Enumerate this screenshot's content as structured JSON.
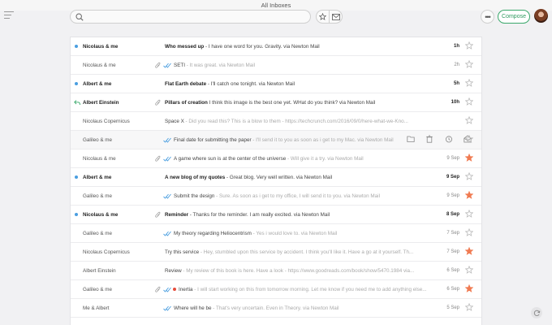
{
  "window": {
    "title": "All Inboxes"
  },
  "toolbar": {
    "search_placeholder": "",
    "more_label": "•••",
    "compose_label": "Compose"
  },
  "colors": {
    "accent": "#2f9a5f",
    "unread_dot": "#4a9ee0",
    "star_active": "#f07b52",
    "label_red": "#e64b3b"
  },
  "icons": [
    "menu-icon",
    "search-icon",
    "star-filter-icon",
    "envelope-filter-icon",
    "more-icon",
    "avatar",
    "reply-icon",
    "paperclip-icon",
    "read-receipt-icon",
    "star-icon",
    "folder-icon",
    "trash-icon",
    "snooze-icon",
    "mark-read-icon",
    "refresh-icon"
  ],
  "emails": [
    {
      "sender": "Nicolaus & me",
      "subject": "Who messed up",
      "preview": " - I have one word for you. Gravity. via Newton Mail",
      "date": "1h",
      "unread": true,
      "dot": true,
      "replied": false,
      "attachment": false,
      "receipt": false,
      "red": false,
      "starred": false,
      "hover": false
    },
    {
      "sender": "Nicolaus & me",
      "subject": "SETI",
      "preview": " - It was great. via Newton Mail",
      "date": "2h",
      "unread": false,
      "dot": false,
      "replied": false,
      "attachment": true,
      "receipt": true,
      "red": false,
      "starred": false,
      "hover": false
    },
    {
      "sender": "Albert & me",
      "subject": "Flat Earth debate",
      "preview": " - I'll catch one tonight. via Newton Mail",
      "date": "5h",
      "unread": true,
      "dot": true,
      "replied": false,
      "attachment": false,
      "receipt": false,
      "red": false,
      "starred": false,
      "hover": false
    },
    {
      "sender": "Albert Einstein",
      "subject": "Pillars of creation",
      "preview": "    I think this image is the best one yet. WHat do you think? via Newton Mail",
      "date": "10h",
      "unread": true,
      "dot": false,
      "replied": true,
      "attachment": true,
      "receipt": false,
      "red": false,
      "starred": false,
      "hover": false
    },
    {
      "sender": "Nicolaus Copernicus",
      "subject": "Space X",
      "preview": " - Did you read this? This is a blow to them - https://techcrunch.com/2016/09/0/here-what-we-Kno...",
      "date": "",
      "unread": false,
      "dot": false,
      "replied": false,
      "attachment": false,
      "receipt": false,
      "red": false,
      "starred": false,
      "hover": false
    },
    {
      "sender": "Galileo & me",
      "subject": "Final date for submitting the paper",
      "preview": " - I'll send it to you as soon as i get to my Mac. via Newton Mail",
      "date": "",
      "unread": false,
      "dot": false,
      "replied": false,
      "attachment": false,
      "receipt": true,
      "red": false,
      "starred": false,
      "hover": true
    },
    {
      "sender": "Nicolaus & me",
      "subject": "A game where sun is at the center of the universe",
      "preview": " - Will give it a try. via Newton Mail",
      "date": "9 Sep",
      "unread": false,
      "dot": false,
      "replied": false,
      "attachment": true,
      "receipt": true,
      "red": false,
      "starred": true,
      "hover": false
    },
    {
      "sender": "Albert & me",
      "subject": "A new blog of my quotes",
      "preview": " - Great blog. Very well written. via Newton Mail",
      "date": "9 Sep",
      "unread": true,
      "dot": true,
      "replied": false,
      "attachment": false,
      "receipt": false,
      "red": false,
      "starred": false,
      "hover": false
    },
    {
      "sender": "Galileo & me",
      "subject": "Submit the design",
      "preview": " - Sure. As soon as i get to my office, I will send it to you. via Newton Mail",
      "date": "9 Sep",
      "unread": false,
      "dot": false,
      "replied": false,
      "attachment": false,
      "receipt": true,
      "red": false,
      "starred": true,
      "hover": false
    },
    {
      "sender": "Nicolaus & me",
      "subject": "Reminder",
      "preview": " - Thanks for the reminder. I am really excited. via Newton Mail",
      "date": "8 Sep",
      "unread": true,
      "dot": true,
      "replied": false,
      "attachment": true,
      "receipt": false,
      "red": false,
      "starred": false,
      "hover": false
    },
    {
      "sender": "Galileo & me",
      "subject": "My theory regarding Heliocentrism",
      "preview": " - Yes i would love to. via Newton Mail",
      "date": "7 Sep",
      "unread": false,
      "dot": false,
      "replied": false,
      "attachment": false,
      "receipt": true,
      "red": false,
      "starred": false,
      "hover": false
    },
    {
      "sender": "Nicolaus Copernicus",
      "subject": "Try this service",
      "preview": " - Hey, stumbled upon this service by accident. I think you'll like it. Have a go at it yourself. Th...",
      "date": "7 Sep",
      "unread": false,
      "dot": false,
      "replied": false,
      "attachment": false,
      "receipt": false,
      "red": false,
      "starred": true,
      "hover": false
    },
    {
      "sender": "Albert Einstein",
      "subject": "Review",
      "preview": " - My review of this book is here. Have a look - https://www.goodreads.com/book/show/5470.1984 via...",
      "date": "6 Sep",
      "unread": false,
      "dot": false,
      "replied": false,
      "attachment": false,
      "receipt": false,
      "red": false,
      "starred": false,
      "hover": false
    },
    {
      "sender": "Galileo & me",
      "subject": "Inertia",
      "preview": " - I will start working on this from tomorrow morning. Let me know if you need me to add anything else...",
      "date": "6 Sep",
      "unread": false,
      "dot": false,
      "replied": false,
      "attachment": true,
      "receipt": true,
      "red": true,
      "starred": true,
      "hover": false
    },
    {
      "sender": "Me & Albert",
      "subject": "Where will he be",
      "preview": " - That's very uncertain. Even in Theory. via Newton Mail",
      "date": "5 Sep",
      "unread": false,
      "dot": false,
      "replied": false,
      "attachment": false,
      "receipt": true,
      "red": false,
      "starred": false,
      "hover": false
    }
  ]
}
